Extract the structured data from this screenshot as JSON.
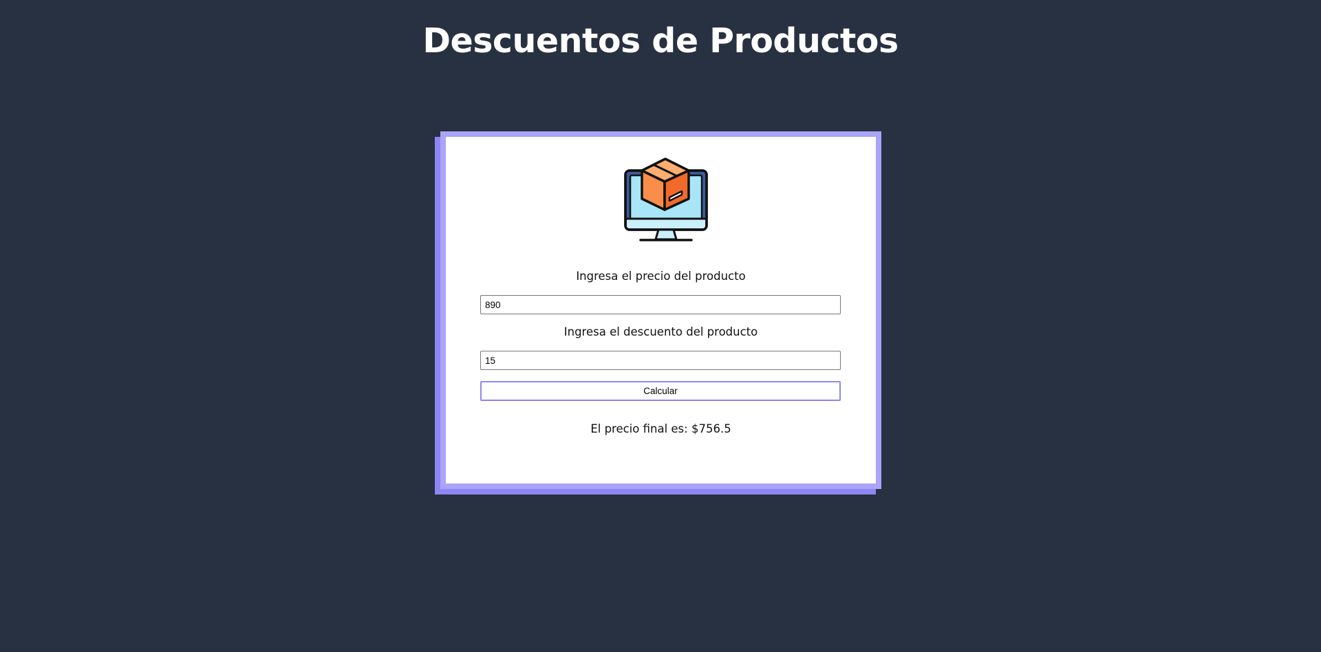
{
  "header": {
    "title": "Descuentos de Productos"
  },
  "card": {
    "icon": "product-box-monitor-icon",
    "price_label": "Ingresa el precio del producto",
    "price_value": "890",
    "discount_label": "Ingresa el descuento del producto",
    "discount_value": "15",
    "calculate_label": "Calcular",
    "result_text": "El precio final es: $756.5"
  },
  "colors": {
    "background": "#283141",
    "card_border": "#aaa4fa",
    "card_shadow": "#8e86f5",
    "button_border": "#8f85f2",
    "box_orange": "#fb8d4a",
    "screen_blue": "#a8e6f7"
  }
}
